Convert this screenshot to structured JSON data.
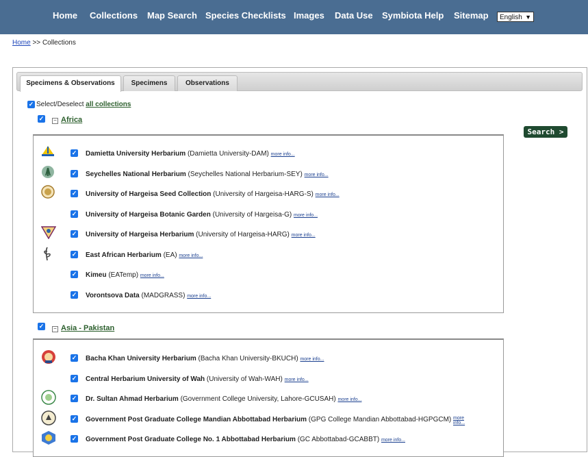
{
  "nav": {
    "items": [
      "Home",
      "Collections",
      "Map Search",
      "Species Checklists",
      "Images",
      "Data Use",
      "Symbiota Help",
      "Sitemap"
    ],
    "language": "English"
  },
  "breadcrumb": {
    "home": "Home",
    "separator": ">>",
    "current": "Collections"
  },
  "tabs": [
    "Specimens & Observations",
    "Specimens",
    "Observations"
  ],
  "select_all": {
    "prefix": "Select/Deselect",
    "link": "all collections"
  },
  "search_button": "Search >",
  "more_info": "more info...",
  "more_info_wrapped": [
    "more",
    "info..."
  ],
  "groups": [
    {
      "name": "Africa",
      "collections": [
        {
          "name": "Damietta University Herbarium",
          "code": "(Damietta University-DAM)",
          "icon": "damietta-logo-icon"
        },
        {
          "name": "Seychelles National Herbarium",
          "code": "(Seychelles National Herbarium-SEY)",
          "icon": "seychelles-logo-icon"
        },
        {
          "name": "University of Hargeisa Seed Collection",
          "code": "(University of Hargeisa-HARG-S)",
          "icon": "hargeisa-seal-icon"
        },
        {
          "name": "University of Hargeisa Botanic Garden",
          "code": "(University of Hargeisa-G)",
          "icon": ""
        },
        {
          "name": "University of Hargeisa Herbarium",
          "code": "(University of Hargeisa-HARG)",
          "icon": "hargeisa-shield-icon"
        },
        {
          "name": "East African Herbarium",
          "code": "(EA)",
          "icon": "plant-sketch-icon"
        },
        {
          "name": "Kimeu",
          "code": "(EATemp)",
          "icon": ""
        },
        {
          "name": "Vorontsova Data",
          "code": "(MADGRASS)",
          "icon": ""
        }
      ]
    },
    {
      "name": "Asia - Pakistan",
      "collections": [
        {
          "name": "Bacha Khan University Herbarium",
          "code": "(Bacha Khan University-BKUCH)",
          "icon": "bacha-khan-logo-icon"
        },
        {
          "name": "Central Herbarium University of Wah",
          "code": "(University of Wah-WAH)",
          "icon": ""
        },
        {
          "name": "Dr. Sultan Ahmad Herbarium",
          "code": "(Government College University, Lahore-GCUSAH)",
          "icon": "gcu-seal-icon"
        },
        {
          "name": "Government Post Graduate College Mandian Abbottabad Herbarium",
          "code": "(GPG College Mandian Abbottabad-HGPGCM)",
          "icon": "gpgc-mandian-logo-icon"
        },
        {
          "name": "Government Post Graduate College No. 1 Abbottabad Herbarium",
          "code": "(GC Abbottabad-GCABBT)",
          "icon": "gpgc-no1-logo-icon"
        }
      ]
    }
  ]
}
